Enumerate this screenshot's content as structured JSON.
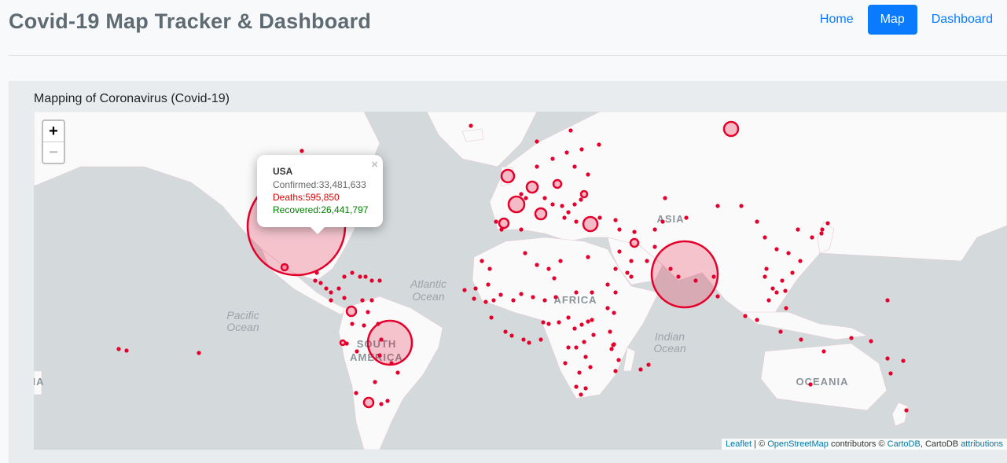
{
  "header": {
    "title": "Covid-19 Map Tracker & Dashboard"
  },
  "nav": {
    "home": "Home",
    "map": "Map",
    "dashboard": "Dashboard"
  },
  "card": {
    "title": "Mapping of Coronavirus (Covid-19)"
  },
  "zoom": {
    "in": "+",
    "out": "−"
  },
  "popup": {
    "country": "USA",
    "confirmed": "Confirmed:33,481,633",
    "deaths": "Deaths:595,850",
    "recovered": "Recovered:26,441,797",
    "close": "×"
  },
  "map_labels": {
    "atlantic_1": "Atlantic",
    "atlantic_2": "Ocean",
    "pacific_1": "Pacific",
    "pacific_2": "Ocean",
    "indian_1": "Indian",
    "indian_2": "Ocean",
    "africa": "AFRICA",
    "asia": "ASIA",
    "south_america_1": "SOUTH",
    "south_america_2": "AMERICA",
    "oceania": "OCEANIA",
    "edge": "IA"
  },
  "attribution": {
    "leaflet": "Leaflet",
    "sep": " | © ",
    "osm": "OpenStreetMap",
    "contrib": " contributors © ",
    "carto": "CartoDB",
    "carto_plain": ", CartoDB ",
    "attributions": "attributions"
  },
  "colors": {
    "marker": "#e5002b",
    "land": "#fafafa",
    "water": "#d4dadc",
    "accent": "#0a7bff"
  }
}
